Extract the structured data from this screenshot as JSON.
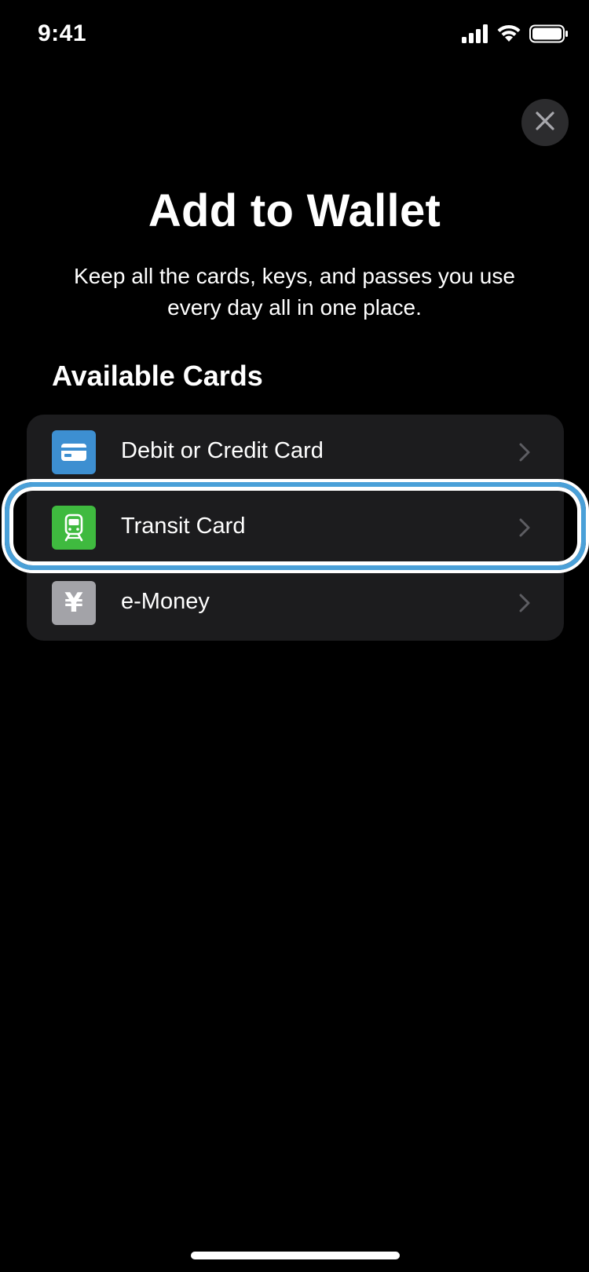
{
  "status_bar": {
    "time": "9:41",
    "icons": [
      "cellular-signal-icon",
      "wifi-icon",
      "battery-icon"
    ]
  },
  "sheet": {
    "close_icon": "close-icon",
    "title": "Add to Wallet",
    "subtitle": "Keep all the cards, keys, and passes you use every day all in one place.",
    "section_heading": "Available Cards",
    "cards": [
      {
        "label": "Debit or Credit Card",
        "icon": "credit-card-icon",
        "color": "#3d8fd1"
      },
      {
        "label": "Transit Card",
        "icon": "train-icon",
        "color": "#3fba3f",
        "highlighted": true
      },
      {
        "label": "e-Money",
        "icon": "yen-icon",
        "glyph": "¥",
        "color": "#8e8e93"
      }
    ]
  },
  "colors": {
    "background": "#000000",
    "list_background": "#1c1c1e",
    "highlight_ring": "#4aa0d8",
    "text": "#ffffff"
  }
}
